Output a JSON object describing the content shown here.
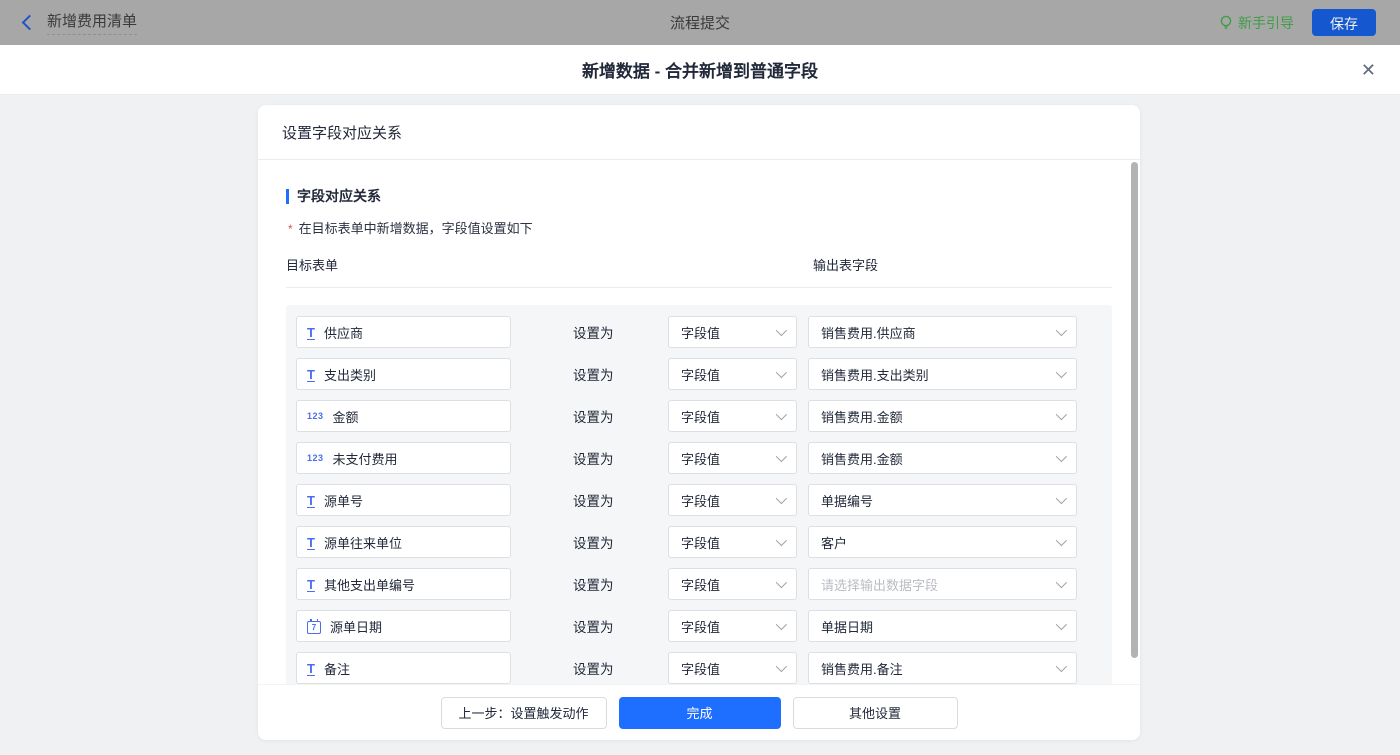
{
  "topbar": {
    "back_label": "新增费用清单",
    "center_title": "流程提交",
    "guide_label": "新手引导",
    "save_label": "保存"
  },
  "modal": {
    "title": "新增数据 - 合并新增到普通字段",
    "close_glyph": "✕"
  },
  "card": {
    "header": "设置字段对应关系",
    "section_title": "字段对应关系",
    "note_marker": "*",
    "note": "在目标表单中新增数据，字段值设置如下",
    "col_left": "目标表单",
    "col_right": "输出表字段",
    "set_as": "设置为"
  },
  "icons": {
    "text_glyph": "T",
    "number_glyph": "123",
    "date_glyph": "7"
  },
  "rows": [
    {
      "icon": "text",
      "field": "供应商",
      "mode": "字段值",
      "output": "销售费用.供应商",
      "output_placeholder": false
    },
    {
      "icon": "text",
      "field": "支出类别",
      "mode": "字段值",
      "output": "销售费用.支出类别",
      "output_placeholder": false
    },
    {
      "icon": "number",
      "field": "金额",
      "mode": "字段值",
      "output": "销售费用.金额",
      "output_placeholder": false
    },
    {
      "icon": "number",
      "field": "未支付费用",
      "mode": "字段值",
      "output": "销售费用.金额",
      "output_placeholder": false
    },
    {
      "icon": "text",
      "field": "源单号",
      "mode": "字段值",
      "output": "单据编号",
      "output_placeholder": false
    },
    {
      "icon": "text",
      "field": "源单往来单位",
      "mode": "字段值",
      "output": "客户",
      "output_placeholder": false
    },
    {
      "icon": "text",
      "field": "其他支出单编号",
      "mode": "字段值",
      "output": "请选择输出数据字段",
      "output_placeholder": true
    },
    {
      "icon": "date",
      "field": "源单日期",
      "mode": "字段值",
      "output": "单据日期",
      "output_placeholder": false
    },
    {
      "icon": "text",
      "field": "备注",
      "mode": "字段值",
      "output": "销售费用.备注",
      "output_placeholder": false
    },
    {
      "icon": "",
      "field": "",
      "mode": "",
      "output": "",
      "output_placeholder": false
    }
  ],
  "footer": {
    "prev": "上一步：设置触发动作",
    "done": "完成",
    "other": "其他设置"
  },
  "colors": {
    "primary_blue": "#1e6fff",
    "field_icon_blue": "#4a6df0",
    "guide_green": "#3f9e48",
    "required_red": "#e34d4d",
    "topbar_dimmed": "#a7a7a7",
    "panel_gray": "#f5f6f7"
  }
}
